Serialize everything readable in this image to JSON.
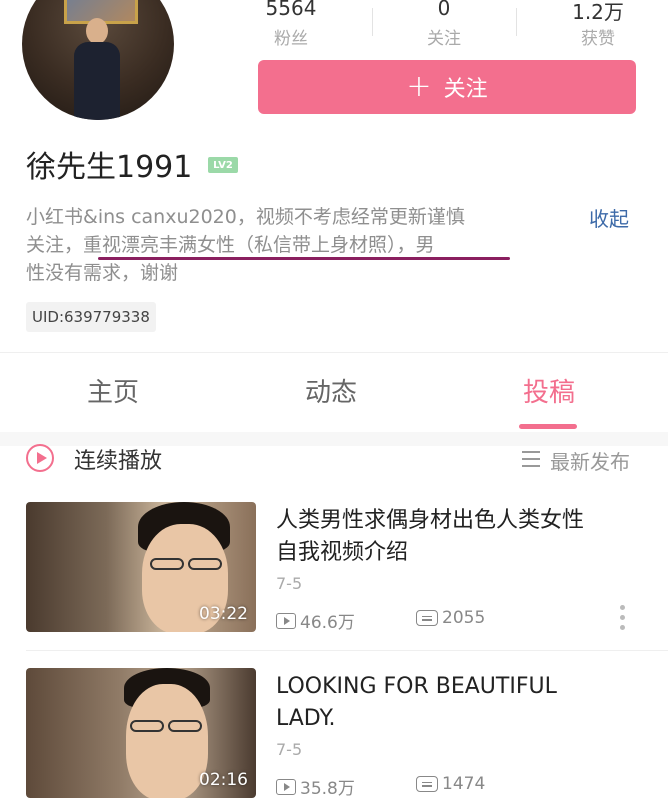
{
  "profile": {
    "stats": [
      {
        "value": "5564",
        "label": "粉丝"
      },
      {
        "value": "0",
        "label": "关注"
      },
      {
        "value": "1.2万",
        "label": "获赞"
      }
    ],
    "follow_button": {
      "icon": "plus-icon",
      "label": "关注"
    },
    "username": "徐先生1991",
    "level": "LV2",
    "bio_lines": [
      "小红书&ins canxu2020，视频不考虑经常更新谨慎",
      "关注，重视漂亮丰满女性（私信带上身材照），男",
      "性没有需求，谢谢"
    ],
    "collapse_label": "收起",
    "uid": "UID:639779338"
  },
  "tabs": [
    {
      "label": "主页",
      "active": false
    },
    {
      "label": "动态",
      "active": false
    },
    {
      "label": "投稿",
      "active": true
    }
  ],
  "toolbar": {
    "autoplay_label": "连续播放",
    "sort_label": "最新发布"
  },
  "videos": [
    {
      "title_lines": [
        "人类男性求偶身材出色人类女性",
        "自我视频介绍"
      ],
      "date": "7-5",
      "duration": "03:22",
      "views": "46.6万",
      "comments": "2055"
    },
    {
      "title_lines": [
        "LOOKING FOR BEAUTIFUL",
        "LADY."
      ],
      "date": "7-5",
      "duration": "02:16",
      "views": "35.8万",
      "comments": "1474"
    }
  ],
  "colors": {
    "accent": "#f36f8e",
    "link": "#3d6aa8",
    "underline_mark": "#8a1f5f",
    "level_badge": "#9bd9a8"
  }
}
